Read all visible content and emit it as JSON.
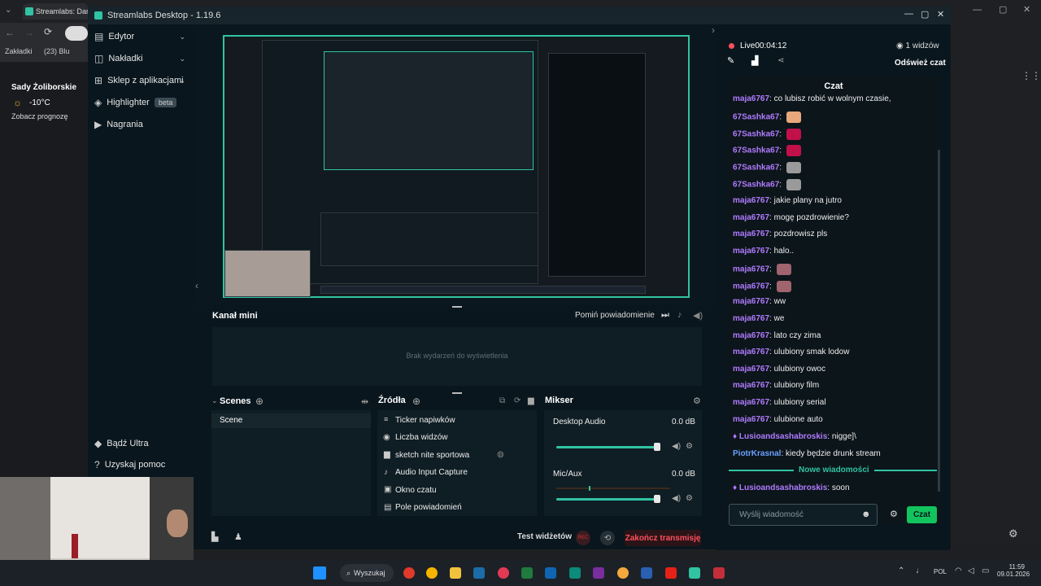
{
  "browser": {
    "tab_title": "Streamlabs: Darm",
    "bookmarks_label": "Zakładki",
    "bookmark_item": "(23) Blu",
    "weather_city": "Sady Żoliborskie",
    "weather_temp": "-10°C",
    "weather_link": "Zobacz prognozę"
  },
  "app": {
    "title": "Streamlabs Desktop - 1.19.6"
  },
  "sidebar": {
    "items": [
      {
        "label": "Edytor",
        "icon": "editor-icon"
      },
      {
        "label": "Nakładki",
        "icon": "overlays-icon"
      },
      {
        "label": "Sklep z aplikacjami",
        "icon": "store-icon"
      },
      {
        "label": "Highlighter",
        "icon": "highlighter-icon",
        "badge": "beta"
      },
      {
        "label": "Nagrania",
        "icon": "recordings-icon"
      }
    ],
    "ultra": "Bądź Ultra",
    "help": "Uzyskaj pomoc"
  },
  "mini_feed": {
    "title": "Kanał mini",
    "skip_label": "Pomiń powiadomienie",
    "empty": "Brak wydarzeń do wyświetlenia"
  },
  "scenes": {
    "title": "Scenes",
    "items": [
      "Scene"
    ]
  },
  "sources": {
    "title": "Źródła",
    "items": [
      "Ticker napiwków",
      "Liczba widzów",
      "sketch nite sportowa",
      "Audio Input Capture",
      "Okno czatu",
      "Pole powiadomień"
    ]
  },
  "mixer": {
    "title": "Mikser",
    "channels": [
      {
        "name": "Desktop Audio",
        "db": "0.0 dB"
      },
      {
        "name": "Mic/Aux",
        "db": "0.0 dB"
      }
    ]
  },
  "footer": {
    "test_widgets": "Test widżetów",
    "rec": "REC",
    "end_stream": "Zakończ transmisję"
  },
  "live": {
    "status": "Live",
    "time": "00:04:12",
    "viewers": "1 widzów",
    "refresh_chat": "Odśwież czat"
  },
  "chat": {
    "title": "Czat",
    "messages": [
      {
        "user": "maja6767",
        "text": "co lubisz robić w wolnym czasie,"
      },
      {
        "user": "67Sashka67",
        "text": "",
        "emote": "#e9a87c"
      },
      {
        "user": "67Sashka67",
        "text": "",
        "emote": "#c2104a"
      },
      {
        "user": "67Sashka67",
        "text": "",
        "emote": "#c2104a"
      },
      {
        "user": "67Sashka67",
        "text": "",
        "emote": "#9a9a9a"
      },
      {
        "user": "67Sashka67",
        "text": "",
        "emote": "#9a9a9a"
      },
      {
        "user": "maja6767",
        "text": "jakie plany na jutro"
      },
      {
        "user": "maja6767",
        "text": "mogę pozdrowienie?"
      },
      {
        "user": "maja6767",
        "text": "pozdrowisz pls"
      },
      {
        "user": "maja6767",
        "text": "halo.."
      },
      {
        "user": "maja6767",
        "text": "",
        "emote": "#a0646e"
      },
      {
        "user": "maja6767",
        "text": "",
        "emote": "#a0646e"
      },
      {
        "user": "maja6767",
        "text": "ww"
      },
      {
        "user": "maja6767",
        "text": "we"
      },
      {
        "user": "maja6767",
        "text": "lato czy zima"
      },
      {
        "user": "maja6767",
        "text": "ulubiony smak lodow"
      },
      {
        "user": "maja6767",
        "text": "ulubiony owoc"
      },
      {
        "user": "maja6767",
        "text": "ulubiony film"
      },
      {
        "user": "maja6767",
        "text": "ulubiony serial"
      },
      {
        "user": "maja6767",
        "text": "ulubione auto"
      },
      {
        "user": "Lusioandsashabroskis",
        "text": "nigge]\\"
      },
      {
        "user": "PiotrKrasnal",
        "text": "kiedy będzie drunk stream"
      }
    ],
    "new_messages": "Nowe wiadomości",
    "last": {
      "user": "Lusioandsashabroskis",
      "text": "soon"
    },
    "input_placeholder": "Wyślij wiadomość",
    "send": "Czat"
  },
  "taskbar": {
    "search": "Wyszukaj",
    "lang": "POL",
    "time": "11:59",
    "date": "09.01.2026"
  }
}
